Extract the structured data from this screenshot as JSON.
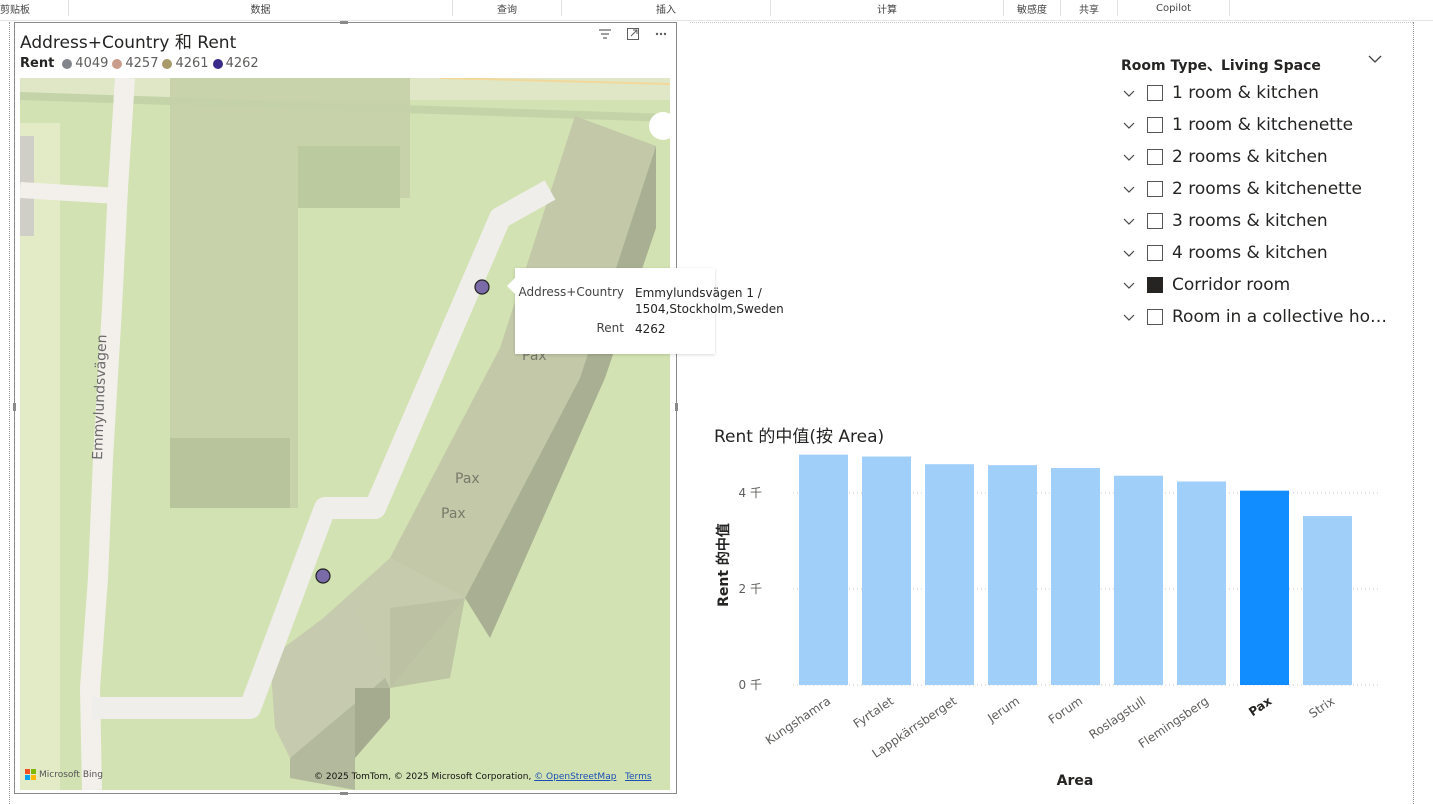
{
  "ribbon": {
    "groups": [
      "剪贴板",
      "数据",
      "查询",
      "插入",
      "计算",
      "敏感度",
      "共享",
      "Copilot"
    ]
  },
  "map_visual": {
    "title": "Address+Country 和 Rent",
    "legend_title": "Rent",
    "legend": [
      {
        "label": "4049",
        "color": "#83858c"
      },
      {
        "label": "4257",
        "color": "#c89d8c"
      },
      {
        "label": "4261",
        "color": "#a99a6a"
      },
      {
        "label": "4262",
        "color": "#3a2a8a"
      }
    ],
    "header_icons": [
      "filter-icon",
      "focus-mode-icon",
      "more-options-icon"
    ],
    "map_labels": {
      "street": "Emmylundsvägen",
      "building_1": "Pax",
      "building_2": "Pax",
      "building_3": "Pax"
    },
    "bing_logo": "Microsoft Bing",
    "copyright": "© 2025 TomTom, © 2025 Microsoft Corporation,",
    "osm_link": "© OpenStreetMap",
    "terms_link": "Terms",
    "point_color": "#7a6aa8"
  },
  "tooltip": {
    "rows": [
      {
        "key": "Address+Country",
        "value_line1": "Emmylundsvägen 1 /",
        "value_line2": "1504,Stockholm,Sweden"
      },
      {
        "key": "Rent",
        "value_line1": "4262",
        "value_line2": ""
      }
    ]
  },
  "slicer": {
    "title": "Room Type、Living Space",
    "items": [
      {
        "label": "1 room & kitchen",
        "checked": false
      },
      {
        "label": "1 room & kitchenette",
        "checked": false
      },
      {
        "label": "2 rooms & kitchen",
        "checked": false
      },
      {
        "label": "2 rooms & kitchenette",
        "checked": false
      },
      {
        "label": "3 rooms & kitchen",
        "checked": false
      },
      {
        "label": "4 rooms & kitchen",
        "checked": false
      },
      {
        "label": "Corridor room",
        "checked": true
      },
      {
        "label": "Room in a collective housi...",
        "checked": false
      }
    ]
  },
  "chart_data": {
    "type": "bar",
    "title": "Rent 的中值(按 Area)",
    "xlabel": "Area",
    "ylabel": "Rent 的中值",
    "categories": [
      "Kungshamra",
      "Fyrtalet",
      "Lappkärrsberget",
      "Jerum",
      "Forum",
      "Roslagstull",
      "Flemingsberg",
      "Pax",
      "Strix"
    ],
    "values": [
      4800,
      4760,
      4600,
      4580,
      4520,
      4360,
      4240,
      4049,
      3520
    ],
    "highlighted": "Pax",
    "ylim": [
      0,
      5000
    ],
    "yticks": [
      0,
      2000,
      4000
    ],
    "ytick_labels": [
      "0 千",
      "2 千",
      "4 千"
    ],
    "colors": {
      "normal": "#a0cff9",
      "highlight": "#118dff"
    },
    "grid": true
  }
}
